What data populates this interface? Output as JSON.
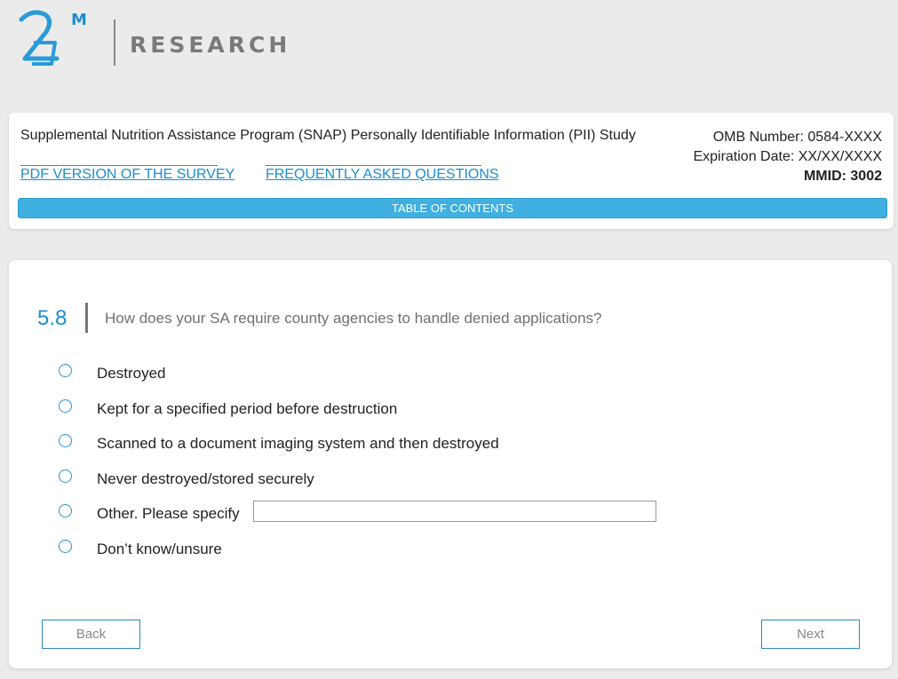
{
  "logo": {
    "mark": "2M",
    "company": "RESEARCH"
  },
  "header": {
    "study_title": "Supplemental Nutrition Assistance Program (SNAP) Personally Identifiable Information (PII) Study",
    "pdf_link": "PDF VERSION OF THE SURVEY",
    "faq_link": "FREQUENTLY ASKED QUESTIONS",
    "omb_number": "OMB Number: 0584-XXXX",
    "expiration": "Expiration Date: XX/XX/XXXX",
    "mmid": "MMID: 3002",
    "toc_label": "TABLE OF CONTENTS"
  },
  "question": {
    "number": "5.8",
    "text": "How does your SA require county agencies to handle denied applications?",
    "options": [
      {
        "label": "Destroyed",
        "selected": false
      },
      {
        "label": "Kept for a specified period before destruction",
        "selected": false
      },
      {
        "label": "Scanned to a document imaging system and then destroyed",
        "selected": false
      },
      {
        "label": "Never destroyed/stored securely",
        "selected": false
      },
      {
        "label": "Other. Please specify",
        "selected": false
      },
      {
        "label": "Don’t know/unsure",
        "selected": false
      }
    ],
    "other_value": ""
  },
  "nav": {
    "back_label": "Back",
    "next_label": "Next"
  },
  "colors": {
    "accent": "#1a8fd0",
    "toc_bar": "#3fb0e0",
    "background": "#ebebeb"
  }
}
